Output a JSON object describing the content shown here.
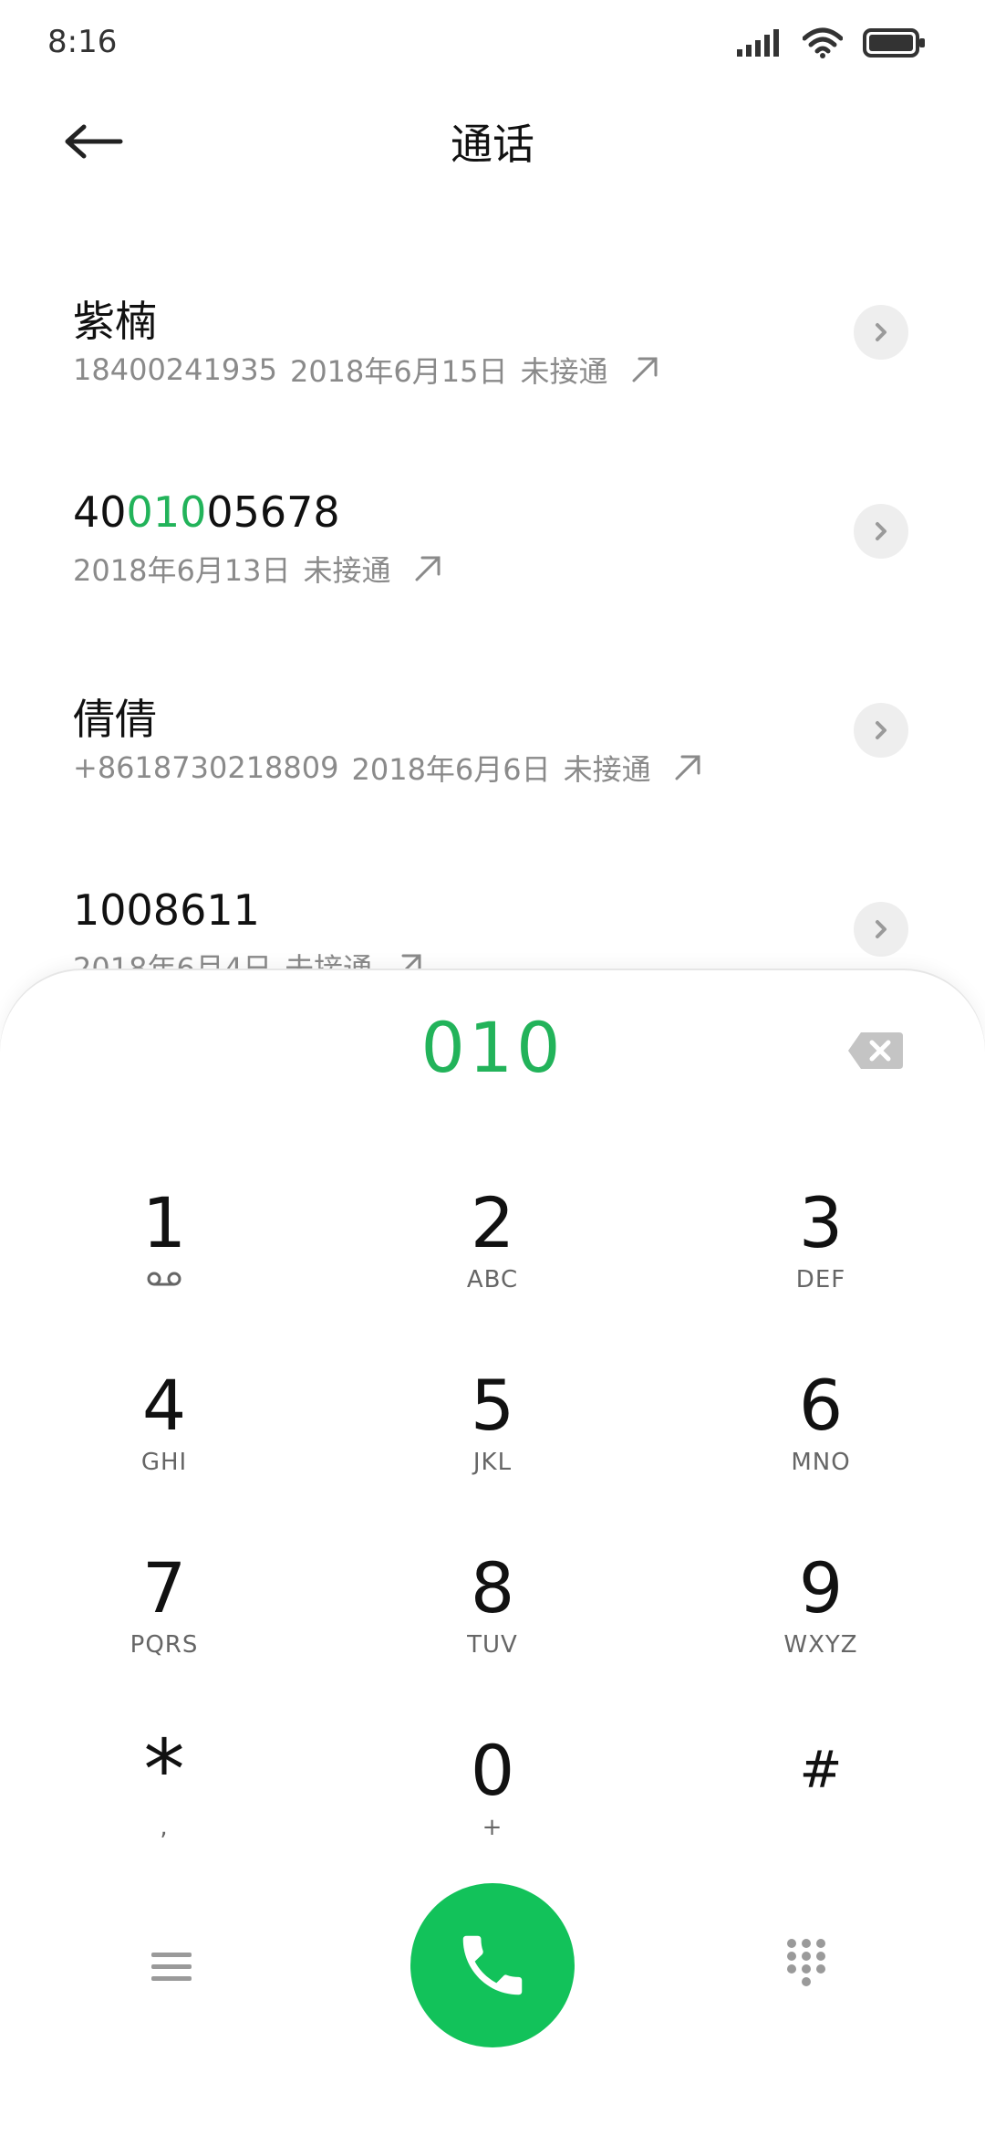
{
  "status": {
    "time": "8:16",
    "icons": [
      "signal-icon",
      "wifi-icon",
      "battery-icon"
    ]
  },
  "header": {
    "title": "通话",
    "back_icon": "arrow-left-icon"
  },
  "calls": [
    {
      "name": "紫楠",
      "number": "18400241935",
      "date": "2018年6月15日",
      "status": "未接通"
    },
    {
      "name_pre": "40",
      "name_hl": "010",
      "name_post": "05678",
      "number": "",
      "date": "2018年6月13日",
      "status": "未接通"
    },
    {
      "name": "倩倩",
      "number": "+8618730218809",
      "date": "2018年6月6日",
      "status": "未接通"
    },
    {
      "name": "1008611",
      "number": "",
      "date": "2018年6月4日",
      "status": "未接通"
    }
  ],
  "dialpad": {
    "input": "010",
    "keys": [
      {
        "digit": "1",
        "sub": ""
      },
      {
        "digit": "2",
        "sub": "ABC"
      },
      {
        "digit": "3",
        "sub": "DEF"
      },
      {
        "digit": "4",
        "sub": "GHI"
      },
      {
        "digit": "5",
        "sub": "JKL"
      },
      {
        "digit": "6",
        "sub": "MNO"
      },
      {
        "digit": "7",
        "sub": "PQRS"
      },
      {
        "digit": "8",
        "sub": "TUV"
      },
      {
        "digit": "9",
        "sub": "WXYZ"
      },
      {
        "digit": "*",
        "sub": ","
      },
      {
        "digit": "0",
        "sub": "+"
      },
      {
        "digit": "#",
        "sub": ""
      }
    ]
  },
  "colors": {
    "accent": "#22b35a",
    "call_button": "#12c25a",
    "secondary_text": "#8a8a8a"
  }
}
